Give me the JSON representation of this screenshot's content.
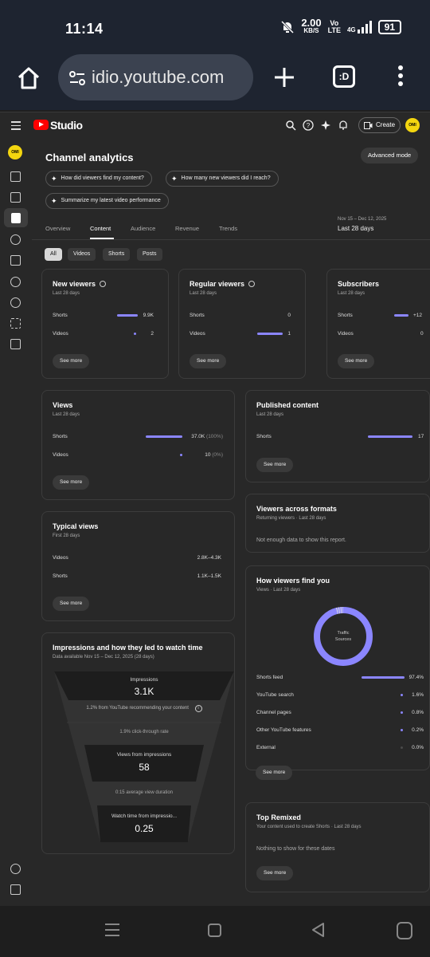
{
  "status_bar": {
    "time": "11:14",
    "speed_value": "2.00",
    "speed_unit": "KB/S",
    "volte": "Vo\nLTE",
    "network": "4G",
    "battery": "91"
  },
  "browser": {
    "url": "idio.youtube.com",
    "tabs_label": ":D"
  },
  "studio": {
    "brand": "Studio",
    "create_label": "Create",
    "avatar_text": "OMI"
  },
  "page": {
    "title": "Channel analytics",
    "advanced_mode": "Advanced mode",
    "questions": [
      "How did viewers find my content?",
      "How many new viewers did I reach?",
      "Summarize my latest video performance"
    ],
    "tabs": [
      "Overview",
      "Content",
      "Audience",
      "Revenue",
      "Trends"
    ],
    "active_tab": "Content",
    "date_range_sub": "Nov 15 – Dec 12, 2025",
    "date_range": "Last 28 days",
    "filters": [
      "All",
      "Videos",
      "Shorts",
      "Posts"
    ],
    "active_filter": "All"
  },
  "cards": {
    "see_more": "See more",
    "new_viewers": {
      "title": "New viewers",
      "subtitle": "Last 28 days",
      "rows": [
        {
          "label": "Shorts",
          "value": "9.9K",
          "share": 1.0
        },
        {
          "label": "Videos",
          "value": "2",
          "share": 0.0
        }
      ]
    },
    "regular_viewers": {
      "title": "Regular viewers",
      "subtitle": "Last 28 days",
      "rows": [
        {
          "label": "Shorts",
          "value": "0",
          "share": 0.0
        },
        {
          "label": "Videos",
          "value": "1",
          "share": 1.0
        }
      ]
    },
    "subscribers": {
      "title": "Subscribers",
      "subtitle": "Last 28 days",
      "rows": [
        {
          "label": "Shorts",
          "value": "+12",
          "share": 1.0
        },
        {
          "label": "Videos",
          "value": "0",
          "share": 0.0
        }
      ]
    },
    "views": {
      "title": "Views",
      "subtitle": "Last 28 days",
      "rows": [
        {
          "label": "Shorts",
          "value": "37.0K",
          "pct": "(100%)",
          "share": 1.0
        },
        {
          "label": "Videos",
          "value": "10",
          "pct": "(0%)",
          "share": 0.0
        }
      ]
    },
    "published_content": {
      "title": "Published content",
      "subtitle": "Last 28 days",
      "rows": [
        {
          "label": "Shorts",
          "value": "17",
          "share": 1.0
        }
      ]
    },
    "typical_views": {
      "title": "Typical views",
      "subtitle": "First 28 days",
      "rows": [
        {
          "label": "Videos",
          "value": "2.8K–4.3K"
        },
        {
          "label": "Shorts",
          "value": "1.1K–1.5K"
        }
      ]
    },
    "viewers_across_formats": {
      "title": "Viewers across formats",
      "subtitle": "Returning viewers · Last 28 days",
      "note": "Not enough data to show this report."
    },
    "impressions": {
      "title": "Impressions and how they led to watch time",
      "subtitle": "Data available Nov 15 – Dec 12, 2025 (28 days)",
      "impressions_label": "Impressions",
      "impressions_value": "3.1K",
      "recommending_note": "1.2% from YouTube recommending your content",
      "ctr": "1.9% click-through rate",
      "views_label": "Views from impressions",
      "views_value": "58",
      "avg_duration": "0:15 average view duration",
      "watch_label": "Watch time from impressio...",
      "watch_value": "0.25"
    },
    "how_viewers_find_you": {
      "title": "How viewers find you",
      "subtitle": "Views · Last 28 days",
      "donut_label": "Traffic\nSources",
      "rows": [
        {
          "label": "Shorts feed",
          "value": "97.4%",
          "share": 0.974
        },
        {
          "label": "YouTube search",
          "value": "1.6%",
          "share": 0.016
        },
        {
          "label": "Channel pages",
          "value": "0.8%",
          "share": 0.008
        },
        {
          "label": "Other YouTube features",
          "value": "0.2%",
          "share": 0.002
        },
        {
          "label": "External",
          "value": "0.0%",
          "share": 0.0
        }
      ]
    },
    "top_remixed": {
      "title": "Top Remixed",
      "subtitle": "Your content used to create Shorts · Last 28 days",
      "note": "Nothing to show for these dates"
    }
  },
  "colors": {
    "accent": "#8b86ff",
    "brand_red": "#ff0000",
    "avatar_yellow": "#f4d60f"
  }
}
